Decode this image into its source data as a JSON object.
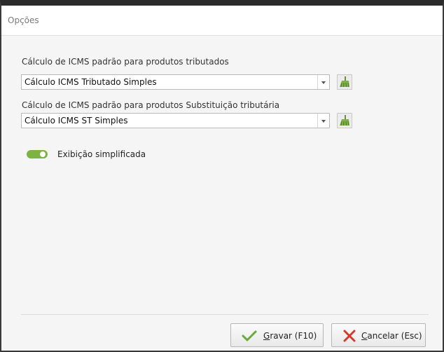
{
  "window": {
    "title": "Opções"
  },
  "form": {
    "tributados": {
      "label": "Cálculo de ICMS padrão para produtos tributados",
      "value": "Cálculo ICMS Tributado Simples"
    },
    "substituicao": {
      "label": "Cálculo de ICMS padrão para produtos Substituição tributária",
      "value": "Cálculo ICMS ST Simples"
    },
    "exibicao": {
      "label": "Exibição simplificada",
      "on": true
    }
  },
  "buttons": {
    "gravar": {
      "mnemonic": "G",
      "rest": "ravar (F10)"
    },
    "cancelar": {
      "mnemonic": "C",
      "rest": "ancelar (Esc)"
    }
  },
  "icons": {
    "clear": "broom-icon",
    "confirm": "checkmark-icon",
    "cancel": "x-icon",
    "dropdown": "chevron-down-icon"
  },
  "colors": {
    "toggle_on": "#7cb342",
    "check_green": "#6aa93b",
    "cancel_red": "#d13b2b"
  }
}
